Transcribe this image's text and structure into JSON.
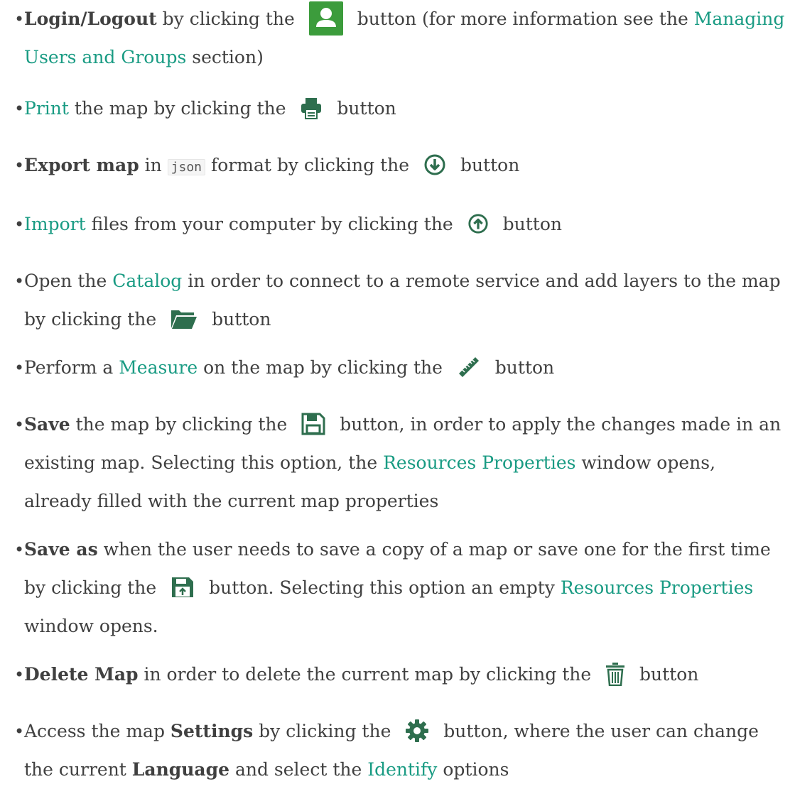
{
  "items": [
    {
      "b": "Login/Logout",
      "t1": " by clicking the ",
      "icon": "user-icon",
      "t2": " button (for more information see the ",
      "link": "Managing Users and Groups",
      "t3": " section)"
    },
    {
      "link": "Print",
      "t1": " the map by clicking the ",
      "icon": "print-icon",
      "t2": " button"
    },
    {
      "b": "Export map",
      "t1": " in ",
      "code": "json",
      "t2": " format by clicking the ",
      "icon": "download-circle-icon",
      "t3": " button"
    },
    {
      "link": "Import",
      "t1": " files from your computer by clicking the ",
      "icon": "upload-circle-icon",
      "t2": " button"
    },
    {
      "t0": "Open the ",
      "link": "Catalog",
      "t1": " in order to connect to a remote service and add layers to the map by clicking the ",
      "icon": "folder-open-icon",
      "t2": " button"
    },
    {
      "t0": "Perform a ",
      "link": "Measure",
      "t1": " on the map by clicking the ",
      "icon": "ruler-icon",
      "t2": " button"
    },
    {
      "b": "Save",
      "t1": " the map by clicking the ",
      "icon": "floppy-icon",
      "t2": " button, in order to apply the changes made in an existing map. Selecting this option, the ",
      "link": "Resources Properties",
      "t3": " window opens, already filled with the current map properties"
    },
    {
      "b": "Save as",
      "t1": " when the user needs to save a copy of a map or save one for the first time by clicking the ",
      "icon": "floppy-upload-icon",
      "t2": " button. Selecting this option an empty ",
      "link": "Resources Properties",
      "t3": " window opens."
    },
    {
      "b": "Delete Map",
      "t1": " in order to delete the current map by clicking the ",
      "icon": "trash-icon",
      "t2": " button"
    },
    {
      "t0": "Access the map ",
      "b": "Settings",
      "t1": " by clicking the ",
      "icon": "gear-icon",
      "t2": " button, where the user can change the current ",
      "b2": "Language",
      "t3": " and select the ",
      "link": "Identify",
      "t4": " options"
    }
  ],
  "bullet": "•"
}
